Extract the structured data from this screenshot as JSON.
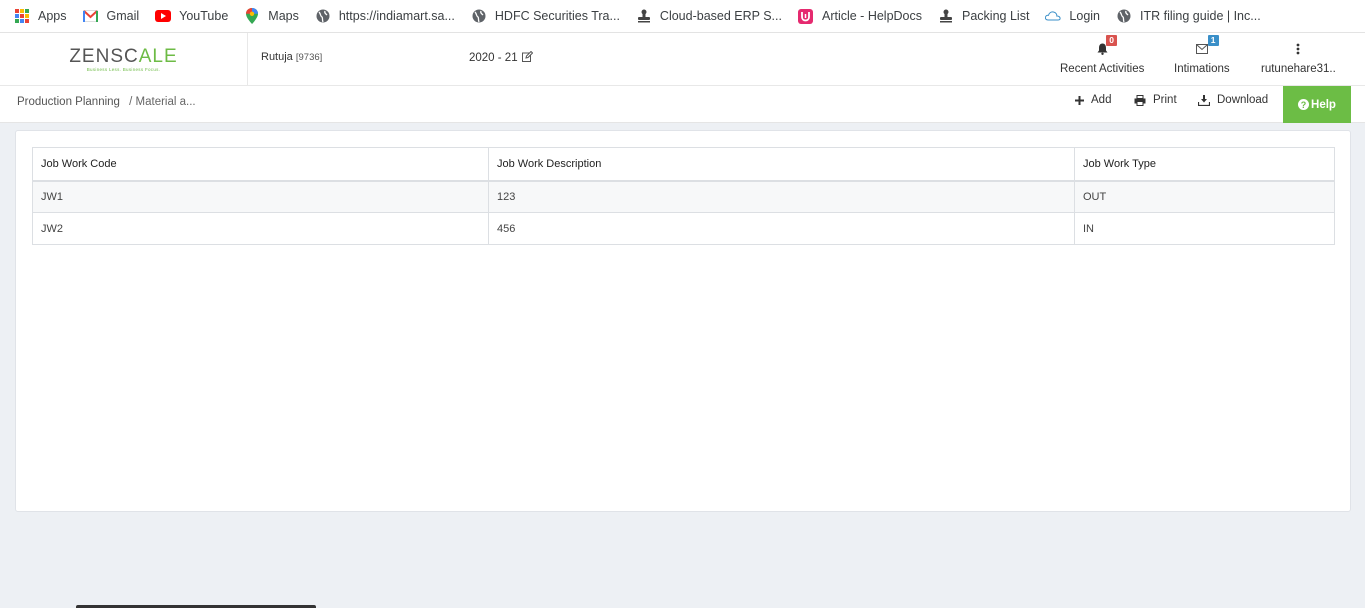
{
  "bookmarks": [
    {
      "label": "Apps",
      "icon": "apps-grid-icon"
    },
    {
      "label": "Gmail",
      "icon": "gmail-icon"
    },
    {
      "label": "YouTube",
      "icon": "youtube-icon"
    },
    {
      "label": "Maps",
      "icon": "maps-pin-icon"
    },
    {
      "label": "https://indiamart.sa...",
      "icon": "globe-icon"
    },
    {
      "label": "HDFC Securities Tra...",
      "icon": "globe-icon"
    },
    {
      "label": "Cloud-based ERP S...",
      "icon": "stamp-icon"
    },
    {
      "label": "Article - HelpDocs",
      "icon": "helpdocs-icon"
    },
    {
      "label": "Packing List",
      "icon": "stamp-icon"
    },
    {
      "label": "Login",
      "icon": "cloud-logo-icon"
    },
    {
      "label": "ITR filing guide | Inc...",
      "icon": "globe-icon"
    }
  ],
  "header": {
    "logo_main": "ZENSC",
    "logo_accent": "A",
    "logo_tail": "LE",
    "logo_tagline": "Business Less. Business Focus.",
    "user_name": "Rutuja",
    "user_code": "[9736]",
    "financial_year": "2020 - 21",
    "recent_activities_label": "Recent Activities",
    "recent_activities_count": "0",
    "intimations_label": "Intimations",
    "intimations_count": "1",
    "account_label": "rutunehare31..",
    "colors": {
      "badge_red": "#d9534f",
      "badge_blue": "#3a8fc8",
      "brand_green": "#6cbd45"
    }
  },
  "toolbar": {
    "breadcrumb_first": "Production Planning",
    "breadcrumb_second": "/ Material a...",
    "add_label": "Add",
    "print_label": "Print",
    "download_label": "Download",
    "help_label": "Help"
  },
  "table": {
    "headers": [
      "Job Work Code",
      "Job Work Description",
      "Job Work Type"
    ],
    "rows": [
      [
        "JW1",
        "123",
        "OUT"
      ],
      [
        "JW2",
        "456",
        "IN"
      ]
    ]
  }
}
